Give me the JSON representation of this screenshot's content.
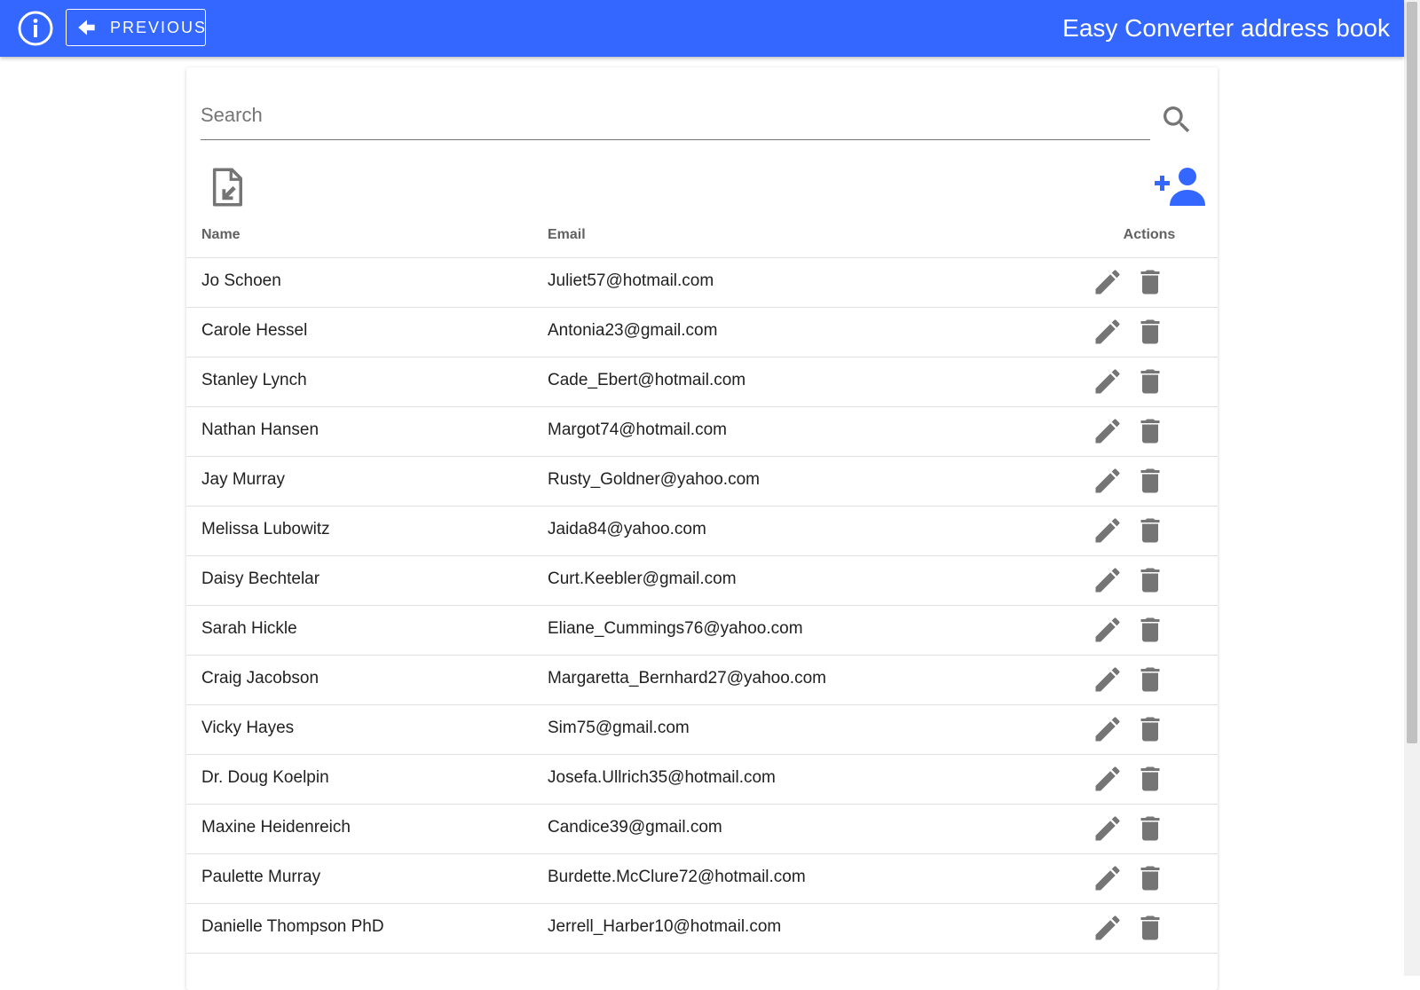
{
  "header": {
    "title": "Easy Converter address book",
    "previous_label": "PREVIOUS",
    "bar_color": "#3367ff"
  },
  "search": {
    "placeholder": "Search",
    "value": ""
  },
  "icons": {
    "info": "info-icon",
    "back": "arrow-left-icon",
    "search": "search-icon",
    "import": "file-import-icon",
    "add_contact": "add-person-icon",
    "edit": "pencil-icon",
    "delete": "trash-icon"
  },
  "colors": {
    "accent": "#3367ff",
    "icon_gray": "#757575"
  },
  "table": {
    "columns": [
      "Name",
      "Email",
      "Actions"
    ],
    "rows": [
      {
        "name": "Jo Schoen",
        "email": "Juliet57@hotmail.com"
      },
      {
        "name": "Carole Hessel",
        "email": "Antonia23@gmail.com"
      },
      {
        "name": "Stanley Lynch",
        "email": "Cade_Ebert@hotmail.com"
      },
      {
        "name": "Nathan Hansen",
        "email": "Margot74@hotmail.com"
      },
      {
        "name": "Jay Murray",
        "email": "Rusty_Goldner@yahoo.com"
      },
      {
        "name": "Melissa Lubowitz",
        "email": "Jaida84@yahoo.com"
      },
      {
        "name": "Daisy Bechtelar",
        "email": "Curt.Keebler@gmail.com"
      },
      {
        "name": "Sarah Hickle",
        "email": "Eliane_Cummings76@yahoo.com"
      },
      {
        "name": "Craig Jacobson",
        "email": "Margaretta_Bernhard27@yahoo.com"
      },
      {
        "name": "Vicky Hayes",
        "email": "Sim75@gmail.com"
      },
      {
        "name": "Dr. Doug Koelpin",
        "email": "Josefa.Ullrich35@hotmail.com"
      },
      {
        "name": "Maxine Heidenreich",
        "email": "Candice39@gmail.com"
      },
      {
        "name": "Paulette Murray",
        "email": "Burdette.McClure72@hotmail.com"
      },
      {
        "name": "Danielle Thompson PhD",
        "email": "Jerrell_Harber10@hotmail.com"
      }
    ]
  }
}
